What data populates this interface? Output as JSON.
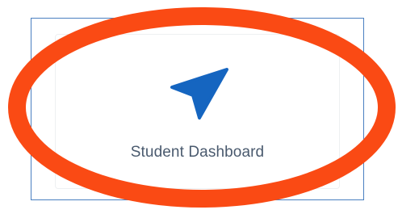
{
  "tile": {
    "label": "Student Dashboard",
    "icon": "navigation-arrow-icon",
    "icon_color": "#1565c0",
    "label_color": "#4a5a6e"
  },
  "annotation": {
    "shape": "ellipse",
    "color": "#fa4a14",
    "frame_color": "#4a7fc1"
  }
}
